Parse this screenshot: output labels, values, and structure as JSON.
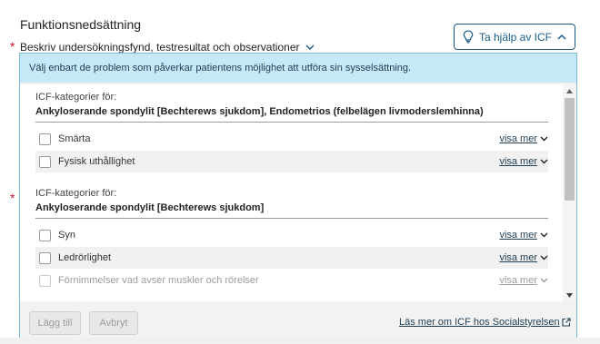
{
  "section": {
    "title": "Funktionsnedsättning"
  },
  "field": {
    "label": "Beskriv undersökningsfynd, testresultat och observationer",
    "required_mark": "*"
  },
  "icf_button": {
    "label": "Ta hjälp av ICF",
    "icon": "lightbulb-icon"
  },
  "panel": {
    "info": "Välj enbart de problem som påverkar patientens möjlighet att utföra sin sysselsättning.",
    "groups": [
      {
        "subtitle": "ICF-kategorier för:",
        "title": "Ankyloserande spondylit [Bechterews sjukdom], Endometrios (felbelägen livmoderslemhinna)",
        "items": [
          {
            "label": "Smärta",
            "show_more": "visa mer",
            "checked": false,
            "disabled": false
          },
          {
            "label": "Fysisk uthållighet",
            "show_more": "visa mer",
            "checked": false,
            "disabled": false
          }
        ]
      },
      {
        "subtitle": "ICF-kategorier för:",
        "title": "Ankyloserande spondylit [Bechterews sjukdom]",
        "items": [
          {
            "label": "Syn",
            "show_more": "visa mer",
            "checked": false,
            "disabled": false
          },
          {
            "label": "Ledrörlighet",
            "show_more": "visa mer",
            "checked": false,
            "disabled": false
          },
          {
            "label": "Förnimmelser vad avser muskler och rörelser",
            "show_more": "visa mer",
            "checked": false,
            "disabled": true
          }
        ]
      }
    ],
    "footer": {
      "add_label": "Lägg till",
      "cancel_label": "Avbryt",
      "link_label": "Läs mer om ICF hos Socialstyrelsen"
    }
  },
  "colors": {
    "accent": "#1a5d88",
    "info_bg": "#c7e8f6",
    "required": "#c8102e"
  }
}
